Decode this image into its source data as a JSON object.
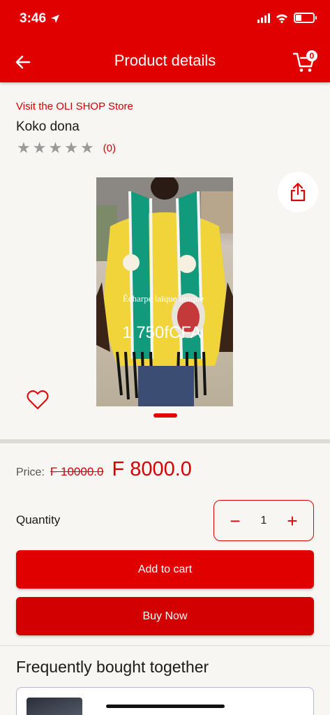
{
  "status": {
    "time": "3:46"
  },
  "header": {
    "title": "Product details",
    "cart_count": "0"
  },
  "product": {
    "store_link": "Visit the OLI SHOP Store",
    "name": "Koko dona",
    "rating_count": "(0)",
    "image_overlay_text": "Écharpe laïque unique",
    "image_overlay_price": "1 750fCFA"
  },
  "price": {
    "label": "Price:",
    "old": "F 10000.0",
    "new": "F 8000.0"
  },
  "quantity": {
    "label": "Quantity",
    "value": "1",
    "minus": "−",
    "plus": "+"
  },
  "actions": {
    "add_to_cart": "Add to cart",
    "buy_now": "Buy Now"
  },
  "related": {
    "title": "Frequently bought together"
  },
  "colors": {
    "brand": "#e10000",
    "star_empty": "#9a9a9a"
  },
  "icons": [
    "location-arrow-icon",
    "signal-icon",
    "wifi-icon",
    "battery-icon",
    "back-arrow-icon",
    "cart-icon",
    "star-icon",
    "share-icon",
    "heart-icon"
  ]
}
